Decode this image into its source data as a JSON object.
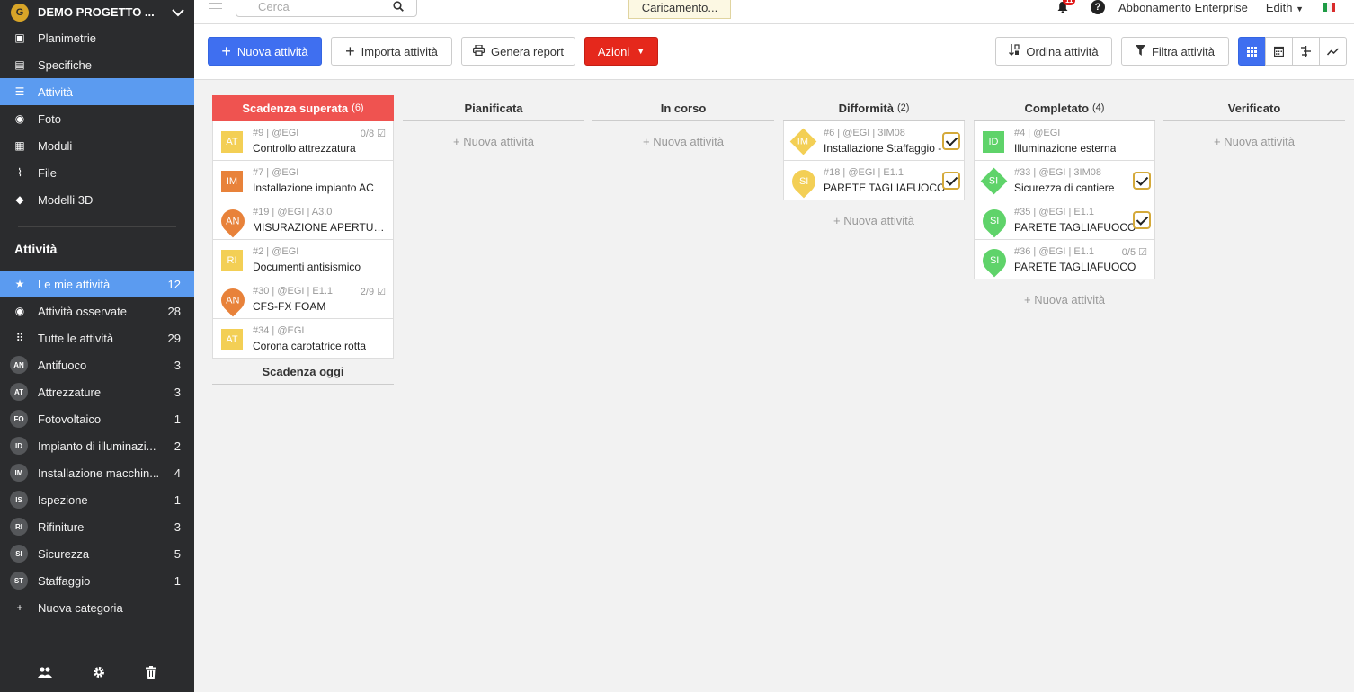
{
  "project": {
    "name": "DEMO PROGETTO ...",
    "logo": "G"
  },
  "nav": [
    {
      "label": "Planimetrie",
      "icon": "floorplan-icon",
      "glyph": "▣"
    },
    {
      "label": "Specifiche",
      "icon": "book-icon",
      "glyph": "▤"
    },
    {
      "label": "Attività",
      "icon": "list-icon",
      "glyph": "☰",
      "active": true
    },
    {
      "label": "Foto",
      "icon": "camera-icon",
      "glyph": "◉"
    },
    {
      "label": "Moduli",
      "icon": "clipboard-icon",
      "glyph": "▦"
    },
    {
      "label": "File",
      "icon": "paperclip-icon",
      "glyph": "⌇"
    },
    {
      "label": "Modelli 3D",
      "icon": "cube-icon",
      "glyph": "◆"
    }
  ],
  "tasks_heading": "Attività",
  "task_nav": [
    {
      "label": "Le mie attività",
      "count": "12",
      "glyph": "★",
      "icon": "star-icon",
      "active": true
    },
    {
      "label": "Attività osservate",
      "count": "28",
      "glyph": "◉",
      "icon": "eye-icon"
    },
    {
      "label": "Tutte le attività",
      "count": "29",
      "glyph": "⠿",
      "icon": "grid-icon"
    }
  ],
  "categories": [
    {
      "code": "AN",
      "label": "Antifuoco",
      "count": "3"
    },
    {
      "code": "AT",
      "label": "Attrezzature",
      "count": "3"
    },
    {
      "code": "FO",
      "label": "Fotovoltaico",
      "count": "1"
    },
    {
      "code": "ID",
      "label": "Impianto di illuminazi...",
      "count": "2"
    },
    {
      "code": "IM",
      "label": "Installazione macchin...",
      "count": "4"
    },
    {
      "code": "IS",
      "label": "Ispezione",
      "count": "1"
    },
    {
      "code": "RI",
      "label": "Rifiniture",
      "count": "3"
    },
    {
      "code": "SI",
      "label": "Sicurezza",
      "count": "5"
    },
    {
      "code": "ST",
      "label": "Staffaggio",
      "count": "1"
    }
  ],
  "new_category": "Nuova categoria",
  "search": {
    "placeholder": "Cerca"
  },
  "loading": "Caricamento...",
  "notifications": "11",
  "help": "?",
  "plan": "Abbonamento Enterprise",
  "user": "Edith",
  "toolbar": {
    "new_task": "Nuova attività",
    "import": "Importa attività",
    "report": "Genera report",
    "actions": "Azioni",
    "sort": "Ordina attività",
    "filter": "Filtra attività"
  },
  "add_task": "+ Nuova attività",
  "columns": [
    {
      "title": "Scadenza superata",
      "count": "(6)",
      "overdue": true,
      "cards": [
        {
          "code": "AT",
          "shape": "sq",
          "color": "#f3cf55",
          "meta": "#9 | @EGI",
          "title": "Controllo attrezzatura",
          "progress": "0/8"
        },
        {
          "code": "IM",
          "shape": "sq",
          "color": "#e8823a",
          "meta": "#7 | @EGI",
          "title": "Installazione impianto AC"
        },
        {
          "code": "AN",
          "shape": "pin",
          "color": "#e8823a",
          "meta": "#19 | @EGI | A3.0",
          "title": "MISURAZIONE APERTUR..."
        },
        {
          "code": "RI",
          "shape": "sq",
          "color": "#f3cf55",
          "meta": "#2 | @EGI",
          "title": "Documenti antisismico"
        },
        {
          "code": "AN",
          "shape": "pin",
          "color": "#e8823a",
          "meta": "#30 | @EGI | E1.1",
          "title": "CFS-FX FOAM",
          "progress": "2/9"
        },
        {
          "code": "AT",
          "shape": "sq",
          "color": "#f3cf55",
          "meta": "#34 | @EGI",
          "title": "Corona carotatrice rotta"
        }
      ],
      "sub": "Scadenza oggi"
    },
    {
      "title": "Pianificata",
      "count": "",
      "cards": []
    },
    {
      "title": "In corso",
      "count": "",
      "cards": []
    },
    {
      "title": "Difformità",
      "count": "(2)",
      "cards": [
        {
          "code": "IM",
          "shape": "dia",
          "color": "#f3cf55",
          "meta": "#6 | @EGI | 3IM08",
          "title": "Installazione Staffaggio -",
          "check": true
        },
        {
          "code": "SI",
          "shape": "pin",
          "color": "#f3cf55",
          "meta": "#18 | @EGI | E1.1",
          "title": "PARETE TAGLIAFUOCO",
          "check": true
        }
      ]
    },
    {
      "title": "Completato",
      "count": "(4)",
      "cards": [
        {
          "code": "ID",
          "shape": "sq",
          "color": "#5fd36a",
          "meta": "#4 | @EGI",
          "title": "Illuminazione esterna"
        },
        {
          "code": "SI",
          "shape": "dia",
          "color": "#5fd36a",
          "meta": "#33 | @EGI | 3IM08",
          "title": "Sicurezza di cantiere",
          "check": true
        },
        {
          "code": "SI",
          "shape": "pin",
          "color": "#5fd36a",
          "meta": "#35 | @EGI | E1.1",
          "title": "PARETE TAGLIAFUOCO",
          "check": true
        },
        {
          "code": "SI",
          "shape": "pin",
          "color": "#5fd36a",
          "meta": "#36 | @EGI | E1.1",
          "title": "PARETE TAGLIAFUOCO",
          "progress": "0/5"
        }
      ]
    },
    {
      "title": "Verificato",
      "count": "",
      "cards": []
    }
  ]
}
